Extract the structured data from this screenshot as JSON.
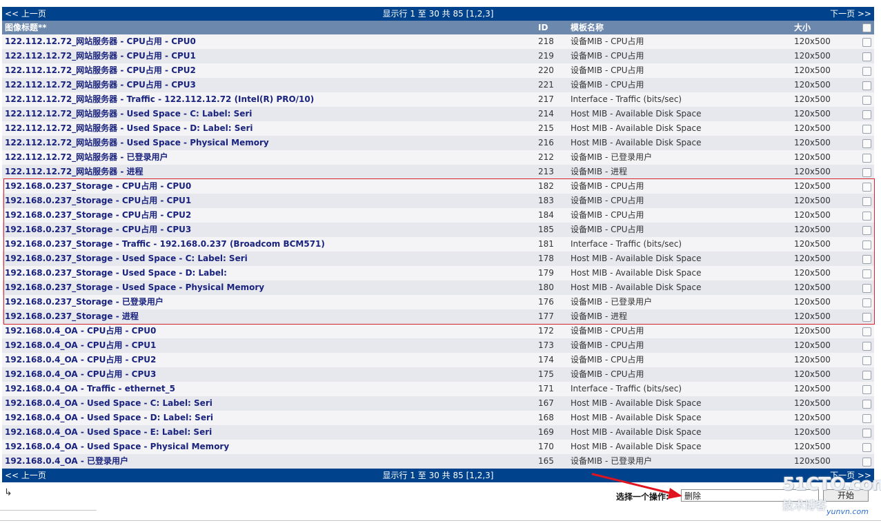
{
  "nav": {
    "prev_label": "<< 上一页",
    "status": "显示行 1 至 30 共 85 [1,2,3]",
    "next_label": "下一页 >>"
  },
  "header": {
    "title": "图像标题**",
    "id": "ID",
    "template": "模板名称",
    "size": "大小"
  },
  "rows": [
    {
      "title": "122.112.12.72_网站服务器 - CPU占用 - CPU0",
      "id": "218",
      "template": "设备MIB - CPU占用",
      "size": "120x500"
    },
    {
      "title": "122.112.12.72_网站服务器 - CPU占用 - CPU1",
      "id": "219",
      "template": "设备MIB - CPU占用",
      "size": "120x500"
    },
    {
      "title": "122.112.12.72_网站服务器 - CPU占用 - CPU2",
      "id": "220",
      "template": "设备MIB - CPU占用",
      "size": "120x500"
    },
    {
      "title": "122.112.12.72_网站服务器 - CPU占用 - CPU3",
      "id": "221",
      "template": "设备MIB - CPU占用",
      "size": "120x500"
    },
    {
      "title": "122.112.12.72_网站服务器 - Traffic - 122.112.12.72 (Intel(R) PRO/10)",
      "id": "217",
      "template": "Interface - Traffic (bits/sec)",
      "size": "120x500"
    },
    {
      "title": "122.112.12.72_网站服务器 - Used Space - C: Label: Seri",
      "id": "214",
      "template": "Host MIB - Available Disk Space",
      "size": "120x500"
    },
    {
      "title": "122.112.12.72_网站服务器 - Used Space - D: Label: Seri",
      "id": "215",
      "template": "Host MIB - Available Disk Space",
      "size": "120x500"
    },
    {
      "title": "122.112.12.72_网站服务器 - Used Space - Physical Memory",
      "id": "216",
      "template": "Host MIB - Available Disk Space",
      "size": "120x500"
    },
    {
      "title": "122.112.12.72_网站服务器 - 已登录用户",
      "id": "212",
      "template": "设备MIB - 已登录用户",
      "size": "120x500"
    },
    {
      "title": "122.112.12.72_网站服务器 - 进程",
      "id": "213",
      "template": "设备MIB - 进程",
      "size": "120x500"
    },
    {
      "title": "192.168.0.237_Storage - CPU占用 - CPU0",
      "id": "182",
      "template": "设备MIB - CPU占用",
      "size": "120x500"
    },
    {
      "title": "192.168.0.237_Storage - CPU占用 - CPU1",
      "id": "183",
      "template": "设备MIB - CPU占用",
      "size": "120x500"
    },
    {
      "title": "192.168.0.237_Storage - CPU占用 - CPU2",
      "id": "184",
      "template": "设备MIB - CPU占用",
      "size": "120x500"
    },
    {
      "title": "192.168.0.237_Storage - CPU占用 - CPU3",
      "id": "185",
      "template": "设备MIB - CPU占用",
      "size": "120x500"
    },
    {
      "title": "192.168.0.237_Storage - Traffic - 192.168.0.237 (Broadcom BCM571)",
      "id": "181",
      "template": "Interface - Traffic (bits/sec)",
      "size": "120x500"
    },
    {
      "title": "192.168.0.237_Storage - Used Space - C: Label: Seri",
      "id": "178",
      "template": "Host MIB - Available Disk Space",
      "size": "120x500"
    },
    {
      "title": "192.168.0.237_Storage - Used Space - D: Label:",
      "id": "179",
      "template": "Host MIB - Available Disk Space",
      "size": "120x500"
    },
    {
      "title": "192.168.0.237_Storage - Used Space - Physical Memory",
      "id": "180",
      "template": "Host MIB - Available Disk Space",
      "size": "120x500"
    },
    {
      "title": "192.168.0.237_Storage - 已登录用户",
      "id": "176",
      "template": "设备MIB - 已登录用户",
      "size": "120x500"
    },
    {
      "title": "192.168.0.237_Storage - 进程",
      "id": "177",
      "template": "设备MIB - 进程",
      "size": "120x500"
    },
    {
      "title": "192.168.0.4_OA - CPU占用 - CPU0",
      "id": "172",
      "template": "设备MIB - CPU占用",
      "size": "120x500"
    },
    {
      "title": "192.168.0.4_OA - CPU占用 - CPU1",
      "id": "173",
      "template": "设备MIB - CPU占用",
      "size": "120x500"
    },
    {
      "title": "192.168.0.4_OA - CPU占用 - CPU2",
      "id": "174",
      "template": "设备MIB - CPU占用",
      "size": "120x500"
    },
    {
      "title": "192.168.0.4_OA - CPU占用 - CPU3",
      "id": "175",
      "template": "设备MIB - CPU占用",
      "size": "120x500"
    },
    {
      "title": "192.168.0.4_OA - Traffic - ethernet_5",
      "id": "171",
      "template": "Interface - Traffic (bits/sec)",
      "size": "120x500"
    },
    {
      "title": "192.168.0.4_OA - Used Space - C: Label: Seri",
      "id": "167",
      "template": "Host MIB - Available Disk Space",
      "size": "120x500"
    },
    {
      "title": "192.168.0.4_OA - Used Space - D: Label: Seri",
      "id": "168",
      "template": "Host MIB - Available Disk Space",
      "size": "120x500"
    },
    {
      "title": "192.168.0.4_OA - Used Space - E: Label: Seri",
      "id": "169",
      "template": "Host MIB - Available Disk Space",
      "size": "120x500"
    },
    {
      "title": "192.168.0.4_OA - Used Space - Physical Memory",
      "id": "170",
      "template": "Host MIB - Available Disk Space",
      "size": "120x500"
    },
    {
      "title": "192.168.0.4_OA - 已登录用户",
      "id": "165",
      "template": "设备MIB - 已登录用户",
      "size": "120x500"
    }
  ],
  "highlight": {
    "first_row": 10,
    "last_row": 19,
    "color": "#d6212a"
  },
  "action": {
    "label": "选择一个操作:",
    "selected": "删除",
    "go_label": "开始"
  },
  "watermark": {
    "big": "51CTO.com",
    "small": "技术博客",
    "url": "yunvn.com"
  },
  "colors": {
    "nav_bg": "#00438c",
    "header_bg": "#6d88ad",
    "row_odd": "#f4f4f6",
    "row_even": "#e6e8ee",
    "title_text": "#1a237e",
    "arrow_red": "#e0141e"
  }
}
